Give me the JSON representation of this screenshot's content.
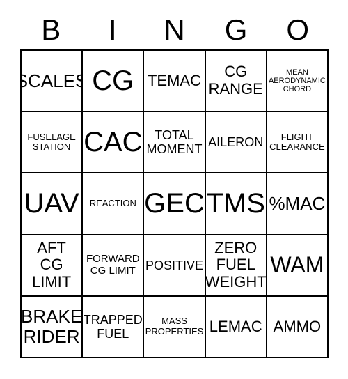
{
  "card": {
    "title_letters": [
      "B",
      "I",
      "N",
      "G",
      "O"
    ],
    "columns": 5,
    "rows": 5,
    "colors": {
      "background": "#ffffff",
      "text": "#000000",
      "grid_line": "#000000"
    },
    "cells": [
      {
        "text": "SCALES",
        "size": "lg"
      },
      {
        "text": "CG",
        "size": "xxl"
      },
      {
        "text": "TEMAC",
        "size": "md"
      },
      {
        "text": "CG\nRANGE",
        "size": "md"
      },
      {
        "text": "MEAN\nAERODYNAMIC\nCHORD",
        "size": "tiny"
      },
      {
        "text": "FUSELAGE\nSTATION",
        "size": "xxs"
      },
      {
        "text": "CAC",
        "size": "xxl"
      },
      {
        "text": "TOTAL\nMOMENT",
        "size": "sm"
      },
      {
        "text": "AILERON",
        "size": "sm"
      },
      {
        "text": "FLIGHT\nCLEARANCE",
        "size": "xxs"
      },
      {
        "text": "UAV",
        "size": "xxl"
      },
      {
        "text": "REACTION",
        "size": "xxs"
      },
      {
        "text": "GEC",
        "size": "xxl"
      },
      {
        "text": "TMS",
        "size": "xxl"
      },
      {
        "text": "%MAC",
        "size": "lg"
      },
      {
        "text": "AFT\nCG\nLIMIT",
        "size": "md"
      },
      {
        "text": "FORWARD\nCG LIMIT",
        "size": "xs"
      },
      {
        "text": "POSITIVE",
        "size": "sm"
      },
      {
        "text": "ZERO\nFUEL\nWEIGHT",
        "size": "md"
      },
      {
        "text": "WAM",
        "size": "xl"
      },
      {
        "text": "BRAKE\nRIDER",
        "size": "lg"
      },
      {
        "text": "TRAPPED\nFUEL",
        "size": "sm"
      },
      {
        "text": "MASS\nPROPERTIES",
        "size": "xxs"
      },
      {
        "text": "LEMAC",
        "size": "md"
      },
      {
        "text": "AMMO",
        "size": "md"
      }
    ]
  }
}
